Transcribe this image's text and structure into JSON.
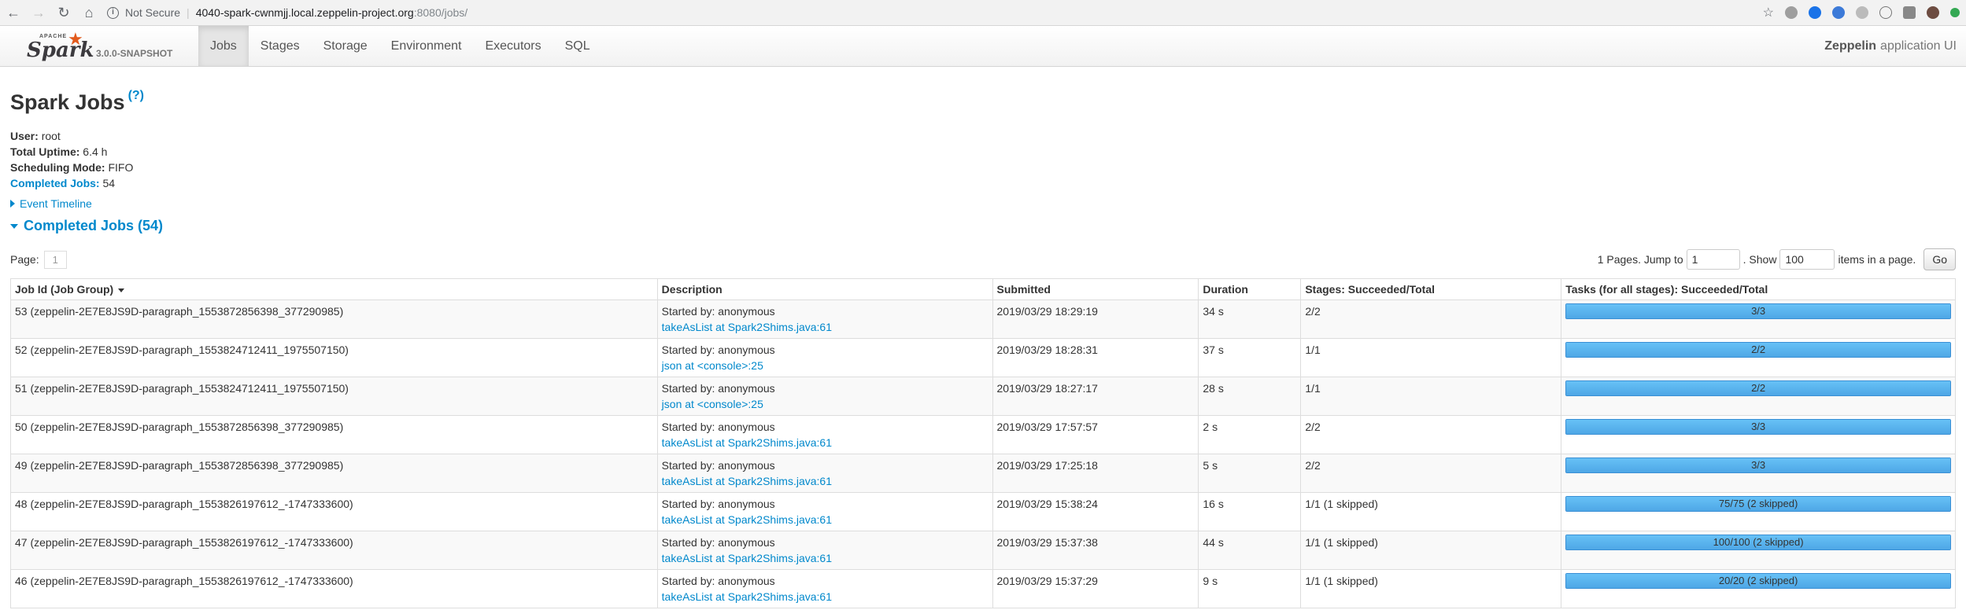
{
  "browser": {
    "security_text": "Not Secure",
    "url_host": "4040-spark-cwnmjj.local.zeppelin-project.org",
    "url_path": ":8080/jobs/"
  },
  "navbar": {
    "logo_apache": "APACHE",
    "logo_text": "Spark",
    "version": "3.0.0-SNAPSHOT",
    "tabs": [
      "Jobs",
      "Stages",
      "Storage",
      "Environment",
      "Executors",
      "SQL"
    ],
    "active_tab": "Jobs",
    "app_name_bold": "Zeppelin",
    "app_name_rest": "application UI"
  },
  "page": {
    "title": "Spark Jobs",
    "help": "(?)",
    "user_label": "User:",
    "user_value": "root",
    "uptime_label": "Total Uptime:",
    "uptime_value": "6.4 h",
    "sched_label": "Scheduling Mode:",
    "sched_value": "FIFO",
    "completed_label": "Completed Jobs:",
    "completed_value": "54",
    "event_timeline": "Event Timeline",
    "section_title": "Completed Jobs (54)"
  },
  "pager": {
    "page_label": "Page:",
    "page_num": "1",
    "pages_text": "1 Pages. Jump to",
    "jump_value": "1",
    "show_text": ". Show",
    "show_value": "100",
    "items_text": "items in a page.",
    "go_label": "Go"
  },
  "table": {
    "headers": [
      "Job Id (Job Group)",
      "Description",
      "Submitted",
      "Duration",
      "Stages: Succeeded/Total",
      "Tasks (for all stages): Succeeded/Total"
    ],
    "rows": [
      {
        "job": "53 (zeppelin-2E7E8JS9D-paragraph_1553872856398_377290985)",
        "started": "Started by: anonymous",
        "link": "takeAsList at Spark2Shims.java:61",
        "submitted": "2019/03/29 18:29:19",
        "duration": "34 s",
        "stages": "2/2",
        "tasks": "3/3",
        "tasks_fraction": 1.0
      },
      {
        "job": "52 (zeppelin-2E7E8JS9D-paragraph_1553824712411_1975507150)",
        "started": "Started by: anonymous",
        "link": "json at <console>:25",
        "submitted": "2019/03/29 18:28:31",
        "duration": "37 s",
        "stages": "1/1",
        "tasks": "2/2",
        "tasks_fraction": 1.0
      },
      {
        "job": "51 (zeppelin-2E7E8JS9D-paragraph_1553824712411_1975507150)",
        "started": "Started by: anonymous",
        "link": "json at <console>:25",
        "submitted": "2019/03/29 18:27:17",
        "duration": "28 s",
        "stages": "1/1",
        "tasks": "2/2",
        "tasks_fraction": 1.0
      },
      {
        "job": "50 (zeppelin-2E7E8JS9D-paragraph_1553872856398_377290985)",
        "started": "Started by: anonymous",
        "link": "takeAsList at Spark2Shims.java:61",
        "submitted": "2019/03/29 17:57:57",
        "duration": "2 s",
        "stages": "2/2",
        "tasks": "3/3",
        "tasks_fraction": 1.0
      },
      {
        "job": "49 (zeppelin-2E7E8JS9D-paragraph_1553872856398_377290985)",
        "started": "Started by: anonymous",
        "link": "takeAsList at Spark2Shims.java:61",
        "submitted": "2019/03/29 17:25:18",
        "duration": "5 s",
        "stages": "2/2",
        "tasks": "3/3",
        "tasks_fraction": 1.0
      },
      {
        "job": "48 (zeppelin-2E7E8JS9D-paragraph_1553826197612_-1747333600)",
        "started": "Started by: anonymous",
        "link": "takeAsList at Spark2Shims.java:61",
        "submitted": "2019/03/29 15:38:24",
        "duration": "16 s",
        "stages": "1/1 (1 skipped)",
        "tasks": "75/75 (2 skipped)",
        "tasks_fraction": 1.0
      },
      {
        "job": "47 (zeppelin-2E7E8JS9D-paragraph_1553826197612_-1747333600)",
        "started": "Started by: anonymous",
        "link": "takeAsList at Spark2Shims.java:61",
        "submitted": "2019/03/29 15:37:38",
        "duration": "44 s",
        "stages": "1/1 (1 skipped)",
        "tasks": "100/100 (2 skipped)",
        "tasks_fraction": 1.0
      },
      {
        "job": "46 (zeppelin-2E7E8JS9D-paragraph_1553826197612_-1747333600)",
        "started": "Started by: anonymous",
        "link": "takeAsList at Spark2Shims.java:61",
        "submitted": "2019/03/29 15:37:29",
        "duration": "9 s",
        "stages": "1/1 (1 skipped)",
        "tasks": "20/20 (2 skipped)",
        "tasks_fraction": 1.0
      }
    ]
  },
  "colors": {
    "link": "#0088cc",
    "progress_fill": "#4ea7e6",
    "spark_orange": "#e25a1c"
  }
}
